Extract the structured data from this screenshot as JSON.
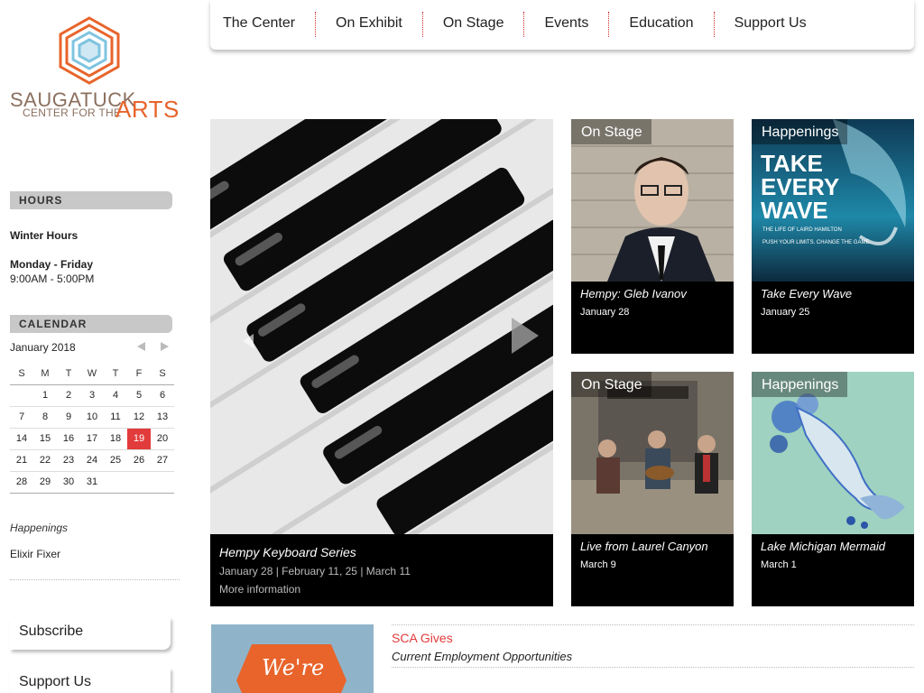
{
  "logo": {
    "line1": "SAUGATUCK",
    "line2": "CENTER FOR THE",
    "line3": "ARTS"
  },
  "nav": {
    "items": [
      "The Center",
      "On Exhibit",
      "On Stage",
      "Events",
      "Education",
      "Support Us"
    ]
  },
  "sidebar": {
    "hours_heading": "HOURS",
    "season": "Winter Hours",
    "days": "Monday - Friday",
    "time": "9:00AM - 5:00PM",
    "calendar_heading": "CALENDAR",
    "happenings_label": "Happenings",
    "happenings_item": "Elixir Fixer",
    "subscribe": "Subscribe",
    "support": "Support Us"
  },
  "calendar": {
    "month": "January 2018",
    "weekdays": [
      "S",
      "M",
      "T",
      "W",
      "T",
      "F",
      "S"
    ],
    "weeks": [
      [
        "",
        "1",
        "2",
        "3",
        "4",
        "5",
        "6"
      ],
      [
        "7",
        "8",
        "9",
        "10",
        "11",
        "12",
        "13"
      ],
      [
        "14",
        "15",
        "16",
        "17",
        "18",
        "19",
        "20"
      ],
      [
        "21",
        "22",
        "23",
        "24",
        "25",
        "26",
        "27"
      ],
      [
        "28",
        "29",
        "30",
        "31",
        "",
        "",
        ""
      ]
    ],
    "highlighted": "19"
  },
  "feature": {
    "title": "Hempy Keyboard Series",
    "dates": "January 28 | February 11, 25 | March 11",
    "more": "More information"
  },
  "cards": [
    {
      "tag": "On Stage",
      "title": "Hempy: Gleb Ivanov",
      "date": "January 28"
    },
    {
      "tag": "Happenings",
      "title": "Take Every Wave",
      "date": "January 25"
    },
    {
      "tag": "On Stage",
      "title": "Live from Laurel Canyon",
      "date": "March 9"
    },
    {
      "tag": "Happenings",
      "title": "Lake Michigan Mermaid",
      "date": "March 1"
    }
  ],
  "poster": {
    "l1": "TAKE",
    "l2": "EVERY",
    "l3": "WAVE",
    "l4": "THE LIFE OF LAIRD HAMILTON",
    "l5": "PUSH YOUR LIMITS. CHANGE THE GAME."
  },
  "promo": {
    "text": "We're"
  },
  "gives": {
    "title": "SCA Gives",
    "subtitle": "Current Employment Opportunities"
  }
}
